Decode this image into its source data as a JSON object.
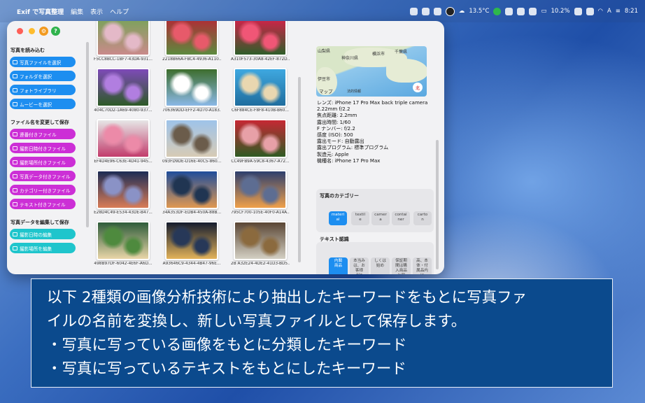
{
  "menubar": {
    "app_name": "Exif で写真整理",
    "menus": [
      "編集",
      "表示",
      "ヘルプ"
    ],
    "temperature": "13.5°C",
    "battery": "10.2%",
    "clock": "8:21"
  },
  "sidebar": {
    "section1_title": "写真を読み込む",
    "load_buttons": [
      "写真ファイルを選択",
      "フォルダを選択",
      "フォトライブラリ",
      "ムービーを選択"
    ],
    "section2_title": "ファイル名を変更して保存",
    "save_buttons": [
      "連番付きファイル",
      "撮影日時付きファイル",
      "撮影場所付きファイル",
      "写真データ付きファイル",
      "カテゴリー付きファイル",
      "テキスト付きファイル"
    ],
    "section3_title": "写真データを編集して保存",
    "edit_buttons": [
      "撮影日時の編集",
      "撮影場所を編集"
    ]
  },
  "photos": [
    {
      "caption": "F5CC8BCC-1BF7-43DA-931...",
      "colors": [
        "#7aa35a",
        "#c98a8a",
        "#e4b9c8"
      ]
    },
    {
      "caption": "2218B66A-FBC4-4936-A110...",
      "colors": [
        "#b22a35",
        "#5d8a3e",
        "#e75a6a"
      ]
    },
    {
      "caption": "A310F573-30A8-42EF-872D...",
      "colors": [
        "#d4214a",
        "#2f5e2a",
        "#f05676"
      ]
    },
    {
      "caption": "404C70D2-1A69-4080-937...",
      "colors": [
        "#7e4ab8",
        "#2d5a26",
        "#b17ee0"
      ]
    },
    {
      "caption": "706369DD-EFF2-4D70-A183...",
      "colors": [
        "#3d6d2d",
        "#8ab8e6",
        "#ffffff"
      ]
    },
    {
      "caption": "C6F884CE-F8F8-410B-B60...",
      "colors": [
        "#3fa8e0",
        "#1f6d9e",
        "#e9d7b0"
      ]
    },
    {
      "caption": "EF4D4E96-C63E-4D41-945...",
      "colors": [
        "#e6e6e6",
        "#c23c6c",
        "#ec8aa8"
      ]
    },
    {
      "caption": "093FD9DE-D16E-40C5-860...",
      "colors": [
        "#9ec3ea",
        "#d7cbb5",
        "#6b5c4b"
      ]
    },
    {
      "caption": "CC49FB9A-59C8-4367-A72...",
      "colors": [
        "#c62834",
        "#2f5b23",
        "#e7a0a7"
      ]
    },
    {
      "caption": "E28D4C49-E534-43DE-B47...",
      "colors": [
        "#1c2c55",
        "#d97c57",
        "#8a92c6"
      ]
    },
    {
      "caption": "34A353DF-EDB4-450A-88B...",
      "colors": [
        "#1f4d9b",
        "#e09850",
        "#203552"
      ]
    },
    {
      "caption": "795CF700-105E-40F0-A14A...",
      "colors": [
        "#2d3f6e",
        "#f0a04a",
        "#5d6d92"
      ]
    },
    {
      "caption": "498B97DF-6042-4E6F-A6D...",
      "colors": [
        "#2e5c3a",
        "#e9d6a8",
        "#4e8a3e"
      ]
    },
    {
      "caption": "A93646C9-4344-4B47-96E...",
      "colors": [
        "#141c2e",
        "#e3b35a",
        "#273858"
      ]
    },
    {
      "caption": "2B A32E24-4DE2-41D3-BD5...",
      "colors": [
        "#5a4634",
        "#d4d0c4",
        "#8b6a3e"
      ]
    }
  ],
  "map": {
    "labels": [
      "山梨県",
      "神奈川県",
      "横浜市",
      "千葉県",
      "伊豆市"
    ],
    "brand": "マップ",
    "legal": "法的情報",
    "compass": "北"
  },
  "info_lines": [
    "レンズ: iPhone 17 Pro Max back triple camera",
    "2.22mm f/2.2",
    "焦点距離: 2.2mm",
    "露出時間: 1/60",
    "F ナンバー: f/2.2",
    "感度 (ISO): 500",
    "露出モード: 自動露出",
    "露出プログラム: 標準プログラム",
    "製造元: Apple",
    "機種名: iPhone 17 Pro Max"
  ],
  "category_card": {
    "title": "写真のカテゴリー",
    "tags": [
      "materi\nal",
      "textil\ne",
      "camer\na",
      "contai\nner",
      "carto\nn"
    ]
  },
  "text_card": {
    "title": "テキスト認識",
    "tags": [
      "内閣\n商品",
      "本当み\nは、お\n客様\nが3",
      "しくは\n始め",
      "保証期\n間は購\n入商品\nと同",
      "高、本\n体・付\n属品内\nに"
    ]
  },
  "caption_panel": {
    "lines": [
      "以下 2種類の画像分析技術により抽出したキーワードをもとに写真ファ",
      "イルの名前を変換し、新しい写真ファイルとして保存します。",
      "・写真に写っている画像をもとに分類したキーワード",
      "・写真に写っているテキストをもとにしたキーワード"
    ]
  },
  "colors": {
    "accent_blue": "#1d8ef0",
    "accent_magenta": "#cc2fd6",
    "accent_teal": "#1fc5cc",
    "panel_bg": "#0b4a8d"
  }
}
